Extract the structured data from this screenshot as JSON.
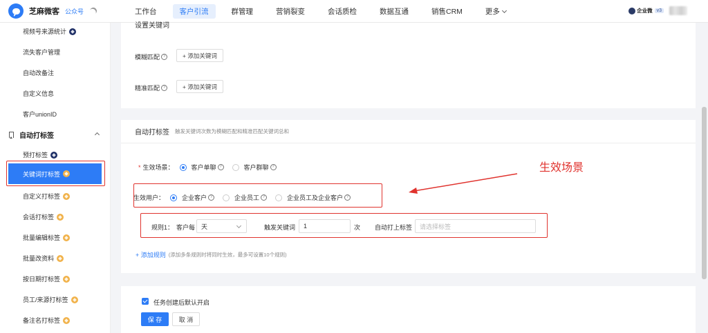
{
  "header": {
    "brand_name": "芝麻微客",
    "brand_sub": "公众号",
    "nav": [
      {
        "label": "工作台"
      },
      {
        "label": "客户引流",
        "active": true
      },
      {
        "label": "群管理"
      },
      {
        "label": "营销裂变"
      },
      {
        "label": "会话质检"
      },
      {
        "label": "数据互通"
      },
      {
        "label": "销售CRM"
      },
      {
        "label": "更多"
      }
    ],
    "wecom_label": "企业微",
    "version_badge": "v3"
  },
  "sidebar": {
    "items_top": [
      {
        "label": "视频号来源统计",
        "badge": "dark-diamond-icon"
      },
      {
        "label": "流失客户管理"
      },
      {
        "label": "自动改备注"
      },
      {
        "label": "自定义信息"
      },
      {
        "label": "客户unionID"
      }
    ],
    "group_label": "自动打标签",
    "items_group": [
      {
        "label": "预打标签",
        "badge": "dark-diamond-icon"
      },
      {
        "label": "关键词打标签",
        "badge": "gold-diamond-icon",
        "active": true
      },
      {
        "label": "自定义打标签",
        "badge": "gold-diamond-icon"
      },
      {
        "label": "会话打标签",
        "badge": "gold-diamond-icon"
      },
      {
        "label": "批量编辑标签",
        "badge": "gold-diamond-icon"
      },
      {
        "label": "批量改资料",
        "badge": "gold-diamond-icon"
      },
      {
        "label": "按日期打标签",
        "badge": "gold-diamond-icon"
      },
      {
        "label": "员工/来源打标签",
        "badge": "gold-diamond-icon"
      },
      {
        "label": "备注名打标签",
        "badge": "gold-diamond-icon"
      }
    ]
  },
  "keywords_section": {
    "partial_title": "设置关键词",
    "fuzzy_label": "模糊匹配",
    "exact_label": "精准匹配",
    "add_keyword_label": "+ 添加关键词"
  },
  "auto_tag_section": {
    "title": "自动打标签",
    "subtitle": "触发关键词次数为模糊匹配和精准匹配关键词总和",
    "scene_label": "生效场景：",
    "scene_options": [
      "客户单聊",
      "客户群聊"
    ],
    "user_label": "生效用户：",
    "user_options": [
      "企业客户",
      "企业员工",
      "企业员工及企业客户"
    ],
    "rule": {
      "label": "规则1：",
      "per_label": "客户每",
      "period_value": "天",
      "trigger_label": "触发关键词",
      "count_value": "1",
      "count_unit": "次",
      "auto_tag_label": "自动打上标签",
      "tag_placeholder": "请选择标签"
    },
    "add_rule_label": "+ 添加规则",
    "add_rule_hint": "(添加多条规则时将同时生效，最多可设置10个规则)"
  },
  "footer": {
    "checkbox_label": "任务创建后默认开启",
    "save_label": "保 存",
    "cancel_label": "取 消"
  },
  "annotation": {
    "text": "生效场景",
    "color": "#e0322d"
  },
  "colors": {
    "accent": "#2d7cf6",
    "highlight": "#e0322d",
    "badge_gold": "#f1b24a",
    "badge_dark": "#1e2f66"
  }
}
